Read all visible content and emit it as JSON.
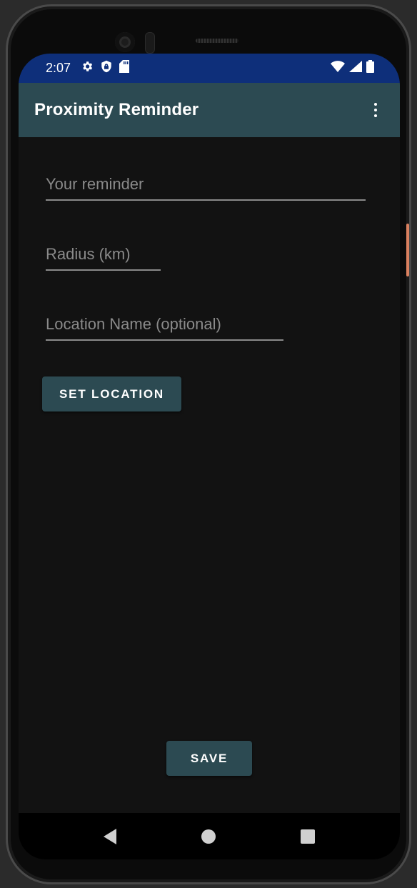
{
  "status_bar": {
    "time": "2:07",
    "left_icons": [
      "gear-icon",
      "shield-icon",
      "sd-card-icon"
    ],
    "right_icons": [
      "wifi-icon",
      "signal-icon",
      "battery-icon"
    ],
    "background_color": "#0e2f7a"
  },
  "app_bar": {
    "title": "Proximity Reminder",
    "menu_icon": "more-vert-icon",
    "background_color": "#2c4a52"
  },
  "form": {
    "reminder": {
      "placeholder": "Your reminder",
      "value": ""
    },
    "radius": {
      "placeholder": "Radius (km)",
      "value": ""
    },
    "location_name": {
      "placeholder": "Location Name (optional)",
      "value": ""
    },
    "set_location_label": "SET LOCATION",
    "save_label": "SAVE"
  },
  "nav_bar": {
    "icons": [
      "back-icon",
      "home-icon",
      "recents-icon"
    ]
  },
  "colors": {
    "screen_background": "#121212",
    "button": "#2c4a52",
    "hint_text": "#8a8a8a"
  }
}
